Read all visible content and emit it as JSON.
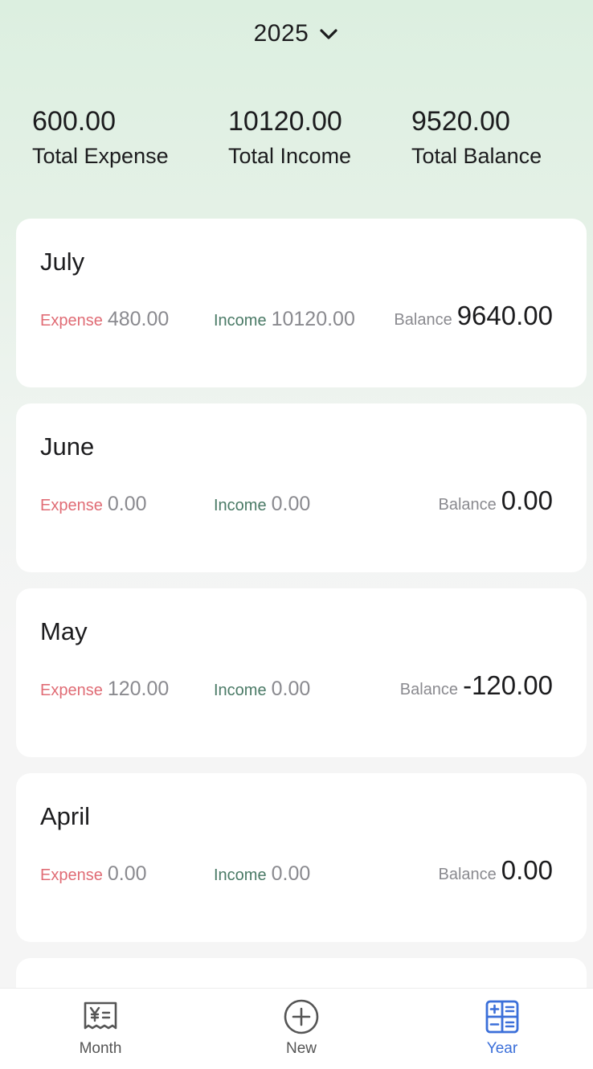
{
  "header": {
    "year": "2025",
    "dropdown_icon": "chevron-down-icon"
  },
  "summary": {
    "expense": {
      "amount": "600.00",
      "label": "Total Expense"
    },
    "income": {
      "amount": "10120.00",
      "label": "Total Income"
    },
    "balance": {
      "amount": "9520.00",
      "label": "Total Balance"
    }
  },
  "labels": {
    "expense": "Expense",
    "income": "Income",
    "balance": "Balance"
  },
  "months": [
    {
      "name": "July",
      "expense": "480.00",
      "income": "10120.00",
      "balance": "9640.00"
    },
    {
      "name": "June",
      "expense": "0.00",
      "income": "0.00",
      "balance": "0.00"
    },
    {
      "name": "May",
      "expense": "120.00",
      "income": "0.00",
      "balance": "-120.00"
    },
    {
      "name": "April",
      "expense": "0.00",
      "income": "0.00",
      "balance": "0.00"
    }
  ],
  "tabbar": {
    "tabs": [
      {
        "label": "Month",
        "icon": "receipt-yen-icon",
        "active": false
      },
      {
        "label": "New",
        "icon": "plus-circle-icon",
        "active": false
      },
      {
        "label": "Year",
        "icon": "calculator-icon",
        "active": true
      }
    ]
  },
  "colors": {
    "expense": "#e06c75",
    "income": "#4a7a66",
    "muted": "#8a8a8f",
    "active_tab": "#3b6fd9",
    "header_bg": "#dcefe0"
  }
}
